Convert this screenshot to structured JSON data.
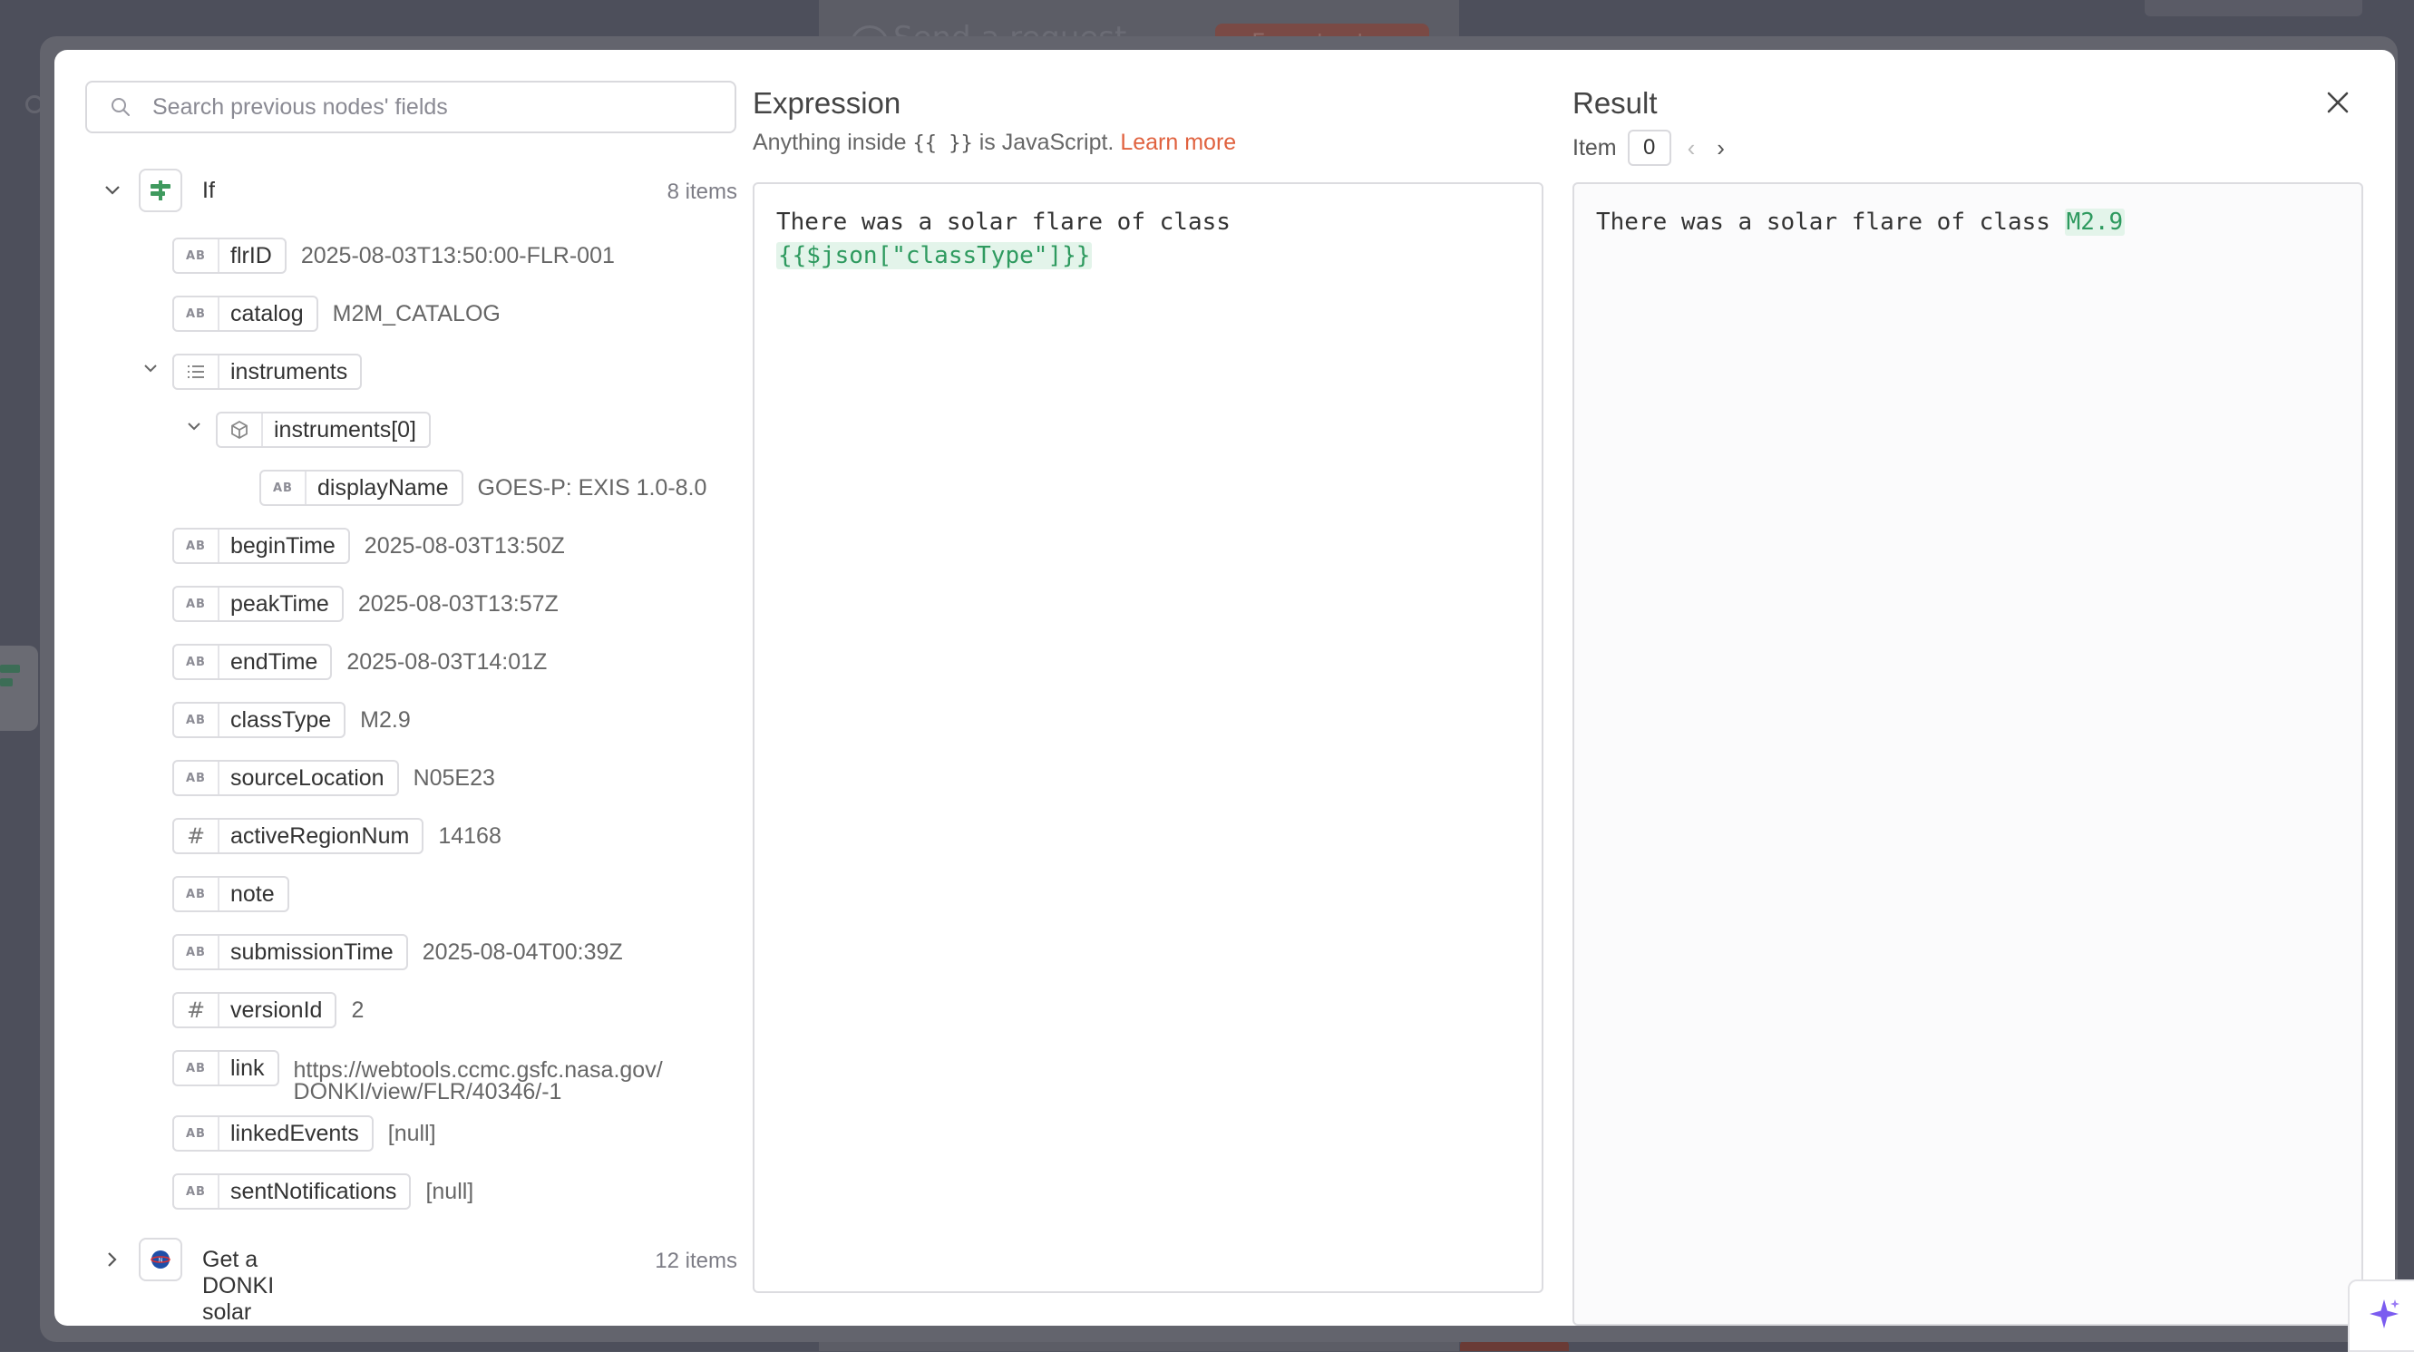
{
  "background": {
    "node_title": "Send a request",
    "execute_label": "Execute step"
  },
  "search": {
    "placeholder": "Search previous nodes' fields"
  },
  "tree": {
    "root": {
      "name": "If",
      "count": "8 items"
    },
    "fields": [
      {
        "type": "AB",
        "label": "flrID",
        "value": "2025-08-03T13:50:00-FLR-001"
      },
      {
        "type": "AB",
        "label": "catalog",
        "value": "M2M_CATALOG"
      },
      {
        "type": "list",
        "label": "instruments",
        "value": ""
      },
      {
        "type": "object",
        "label": "instruments[0]",
        "value": ""
      },
      {
        "type": "AB",
        "label": "displayName",
        "value": "GOES-P: EXIS 1.0-8.0"
      },
      {
        "type": "AB",
        "label": "beginTime",
        "value": "2025-08-03T13:50Z"
      },
      {
        "type": "AB",
        "label": "peakTime",
        "value": "2025-08-03T13:57Z"
      },
      {
        "type": "AB",
        "label": "endTime",
        "value": "2025-08-03T14:01Z"
      },
      {
        "type": "AB",
        "label": "classType",
        "value": "M2.9"
      },
      {
        "type": "AB",
        "label": "sourceLocation",
        "value": "N05E23"
      },
      {
        "type": "#",
        "label": "activeRegionNum",
        "value": "14168"
      },
      {
        "type": "AB",
        "label": "note",
        "value": ""
      },
      {
        "type": "AB",
        "label": "submissionTime",
        "value": "2025-08-04T00:39Z"
      },
      {
        "type": "#",
        "label": "versionId",
        "value": "2"
      },
      {
        "type": "AB",
        "label": "link",
        "value": "https://webtools.ccmc.gsfc.nasa.gov/ DONKI/view/FLR/40346/-1"
      },
      {
        "type": "AB",
        "label": "linkedEvents",
        "value": "[null]"
      },
      {
        "type": "AB",
        "label": "sentNotifications",
        "value": "[null]"
      }
    ],
    "second": {
      "name": "Get a DONKI solar flare",
      "count": "12 items"
    }
  },
  "expression": {
    "title": "Expression",
    "sub_pre": "Anything inside",
    "sub_braces": "{{ }}",
    "sub_post": "is JavaScript.",
    "learn_more": "Learn more",
    "text": "There was a solar flare of class",
    "code": "{{$json[\"classType\"]}}"
  },
  "result": {
    "title": "Result",
    "item_label": "Item",
    "item_value": "0",
    "text": "There was a solar flare of class",
    "value": "M2.9"
  },
  "colors": {
    "accent": "#e0623f",
    "highlight": "#2e9a5f",
    "highlight_bg": "#e3f4ea"
  }
}
